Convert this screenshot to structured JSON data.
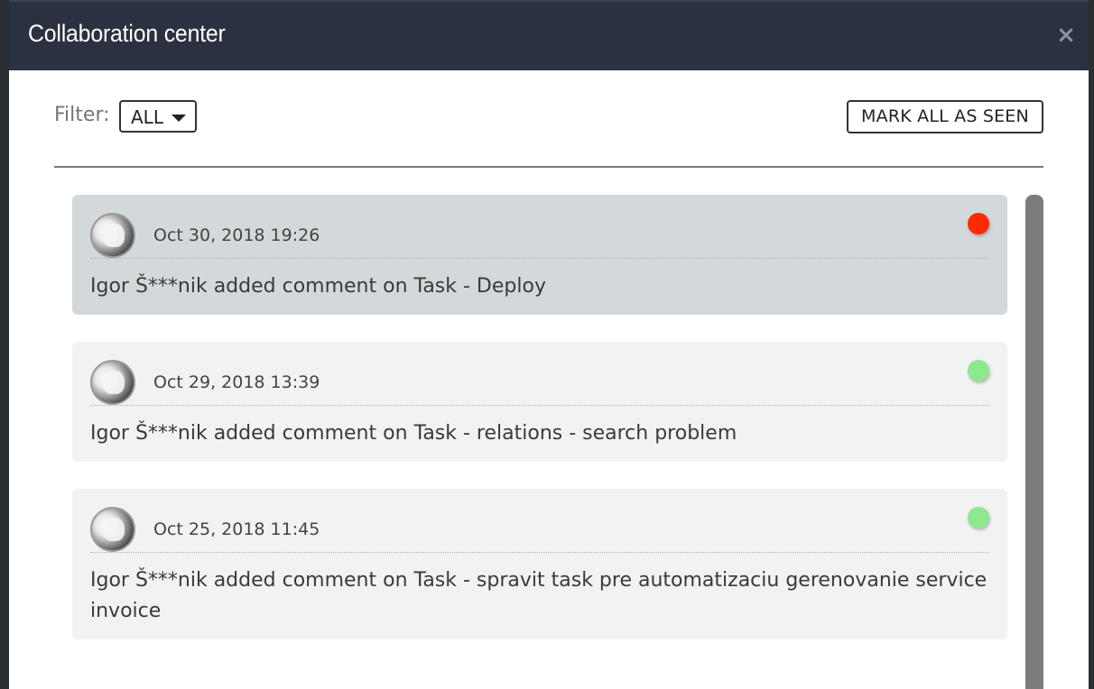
{
  "modal": {
    "title": "Collaboration center",
    "close_glyph": "×"
  },
  "filter": {
    "label": "Filter:",
    "value": "ALL"
  },
  "actions": {
    "mark_all_label": "MARK ALL AS SEEN"
  },
  "notifications": [
    {
      "timestamp": "Oct 30, 2018 19:26",
      "message": "Igor Š***nik added comment on Task - Deploy",
      "status": "unseen",
      "status_color": "#ff2a00"
    },
    {
      "timestamp": "Oct 29, 2018 13:39",
      "message": "Igor Š***nik added comment on Task - relations - search problem",
      "status": "seen",
      "status_color": "#8ee88e"
    },
    {
      "timestamp": "Oct 25, 2018 11:45",
      "message": "Igor Š***nik added comment on Task - spravit task pre automatizaciu gerenovanie service invoice",
      "status": "seen",
      "status_color": "#8ee88e"
    }
  ],
  "colors": {
    "header_bg": "#2b3140",
    "unseen_card_bg": "#d3d9da",
    "seen_card_bg": "#f2f2f2"
  }
}
